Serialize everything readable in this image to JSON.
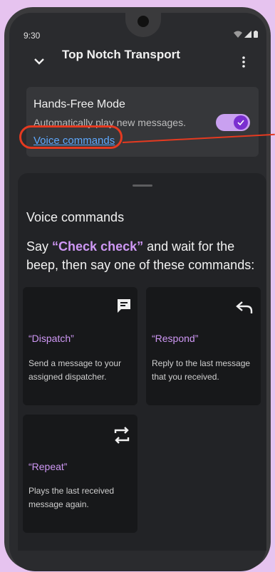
{
  "status": {
    "time": "9:30"
  },
  "app": {
    "title": "Top Notch Transport"
  },
  "hands_free": {
    "title": "Hands-Free Mode",
    "subtitle": "Automatically play new messages.",
    "link": "Voice commands",
    "toggle_on": true
  },
  "sheet": {
    "title": "Voice commands",
    "instruction_prefix": "Say ",
    "instruction_keyword": "“Check check”",
    "instruction_suffix": " and wait for the beep, then say one of these commands:",
    "commands": [
      {
        "name": "“Dispatch”",
        "description": "Send a message to your assigned dispatcher.",
        "icon": "message-icon"
      },
      {
        "name": "“Respond”",
        "description": "Reply to the last message that you received.",
        "icon": "reply-icon"
      },
      {
        "name": "“Repeat”",
        "description": "Plays the last received message again.",
        "icon": "repeat-icon"
      }
    ]
  },
  "colors": {
    "accent": "#cf98f5",
    "link": "#5ea9ff",
    "highlight": "#e53a20"
  }
}
